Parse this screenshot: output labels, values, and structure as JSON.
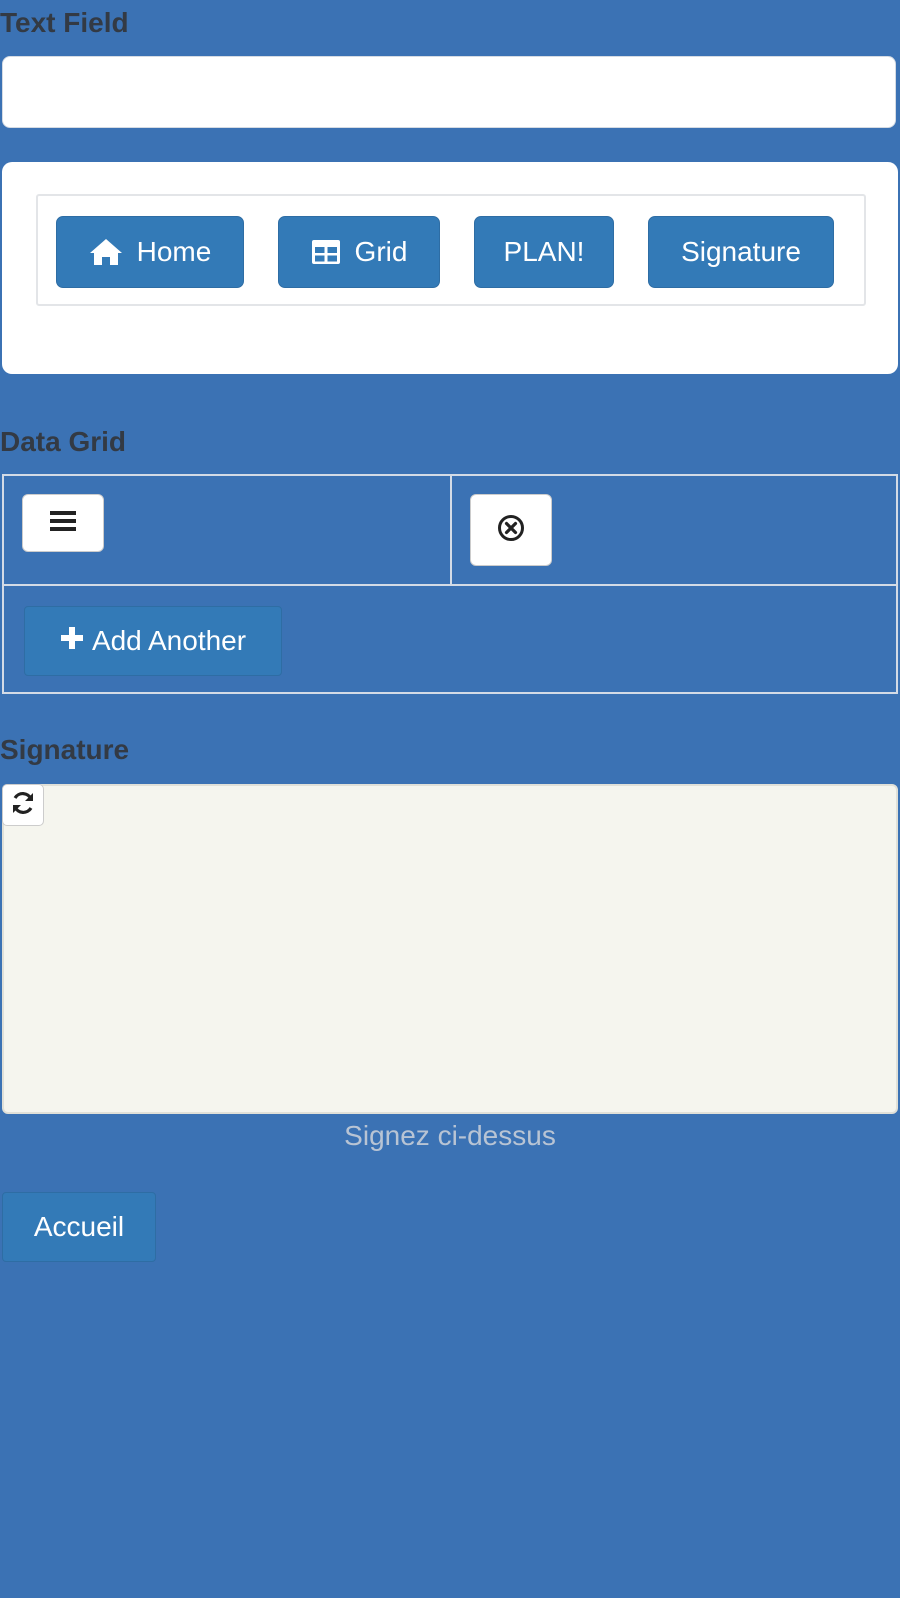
{
  "text_field": {
    "label": "Text Field",
    "value": "",
    "placeholder": ""
  },
  "nav": {
    "buttons": [
      {
        "label": "Home",
        "icon": "home-icon"
      },
      {
        "label": "Grid",
        "icon": "table-icon"
      },
      {
        "label": "PLAN!",
        "icon": ""
      },
      {
        "label": "Signature",
        "icon": ""
      }
    ]
  },
  "data_grid": {
    "label": "Data Grid",
    "row_menu_icon": "bars-icon",
    "row_remove_icon": "remove-circle-icon",
    "add_label": "Add Another",
    "add_icon": "plus-icon"
  },
  "signature": {
    "label": "Signature",
    "refresh_icon": "refresh-icon",
    "hint": "Signez ci-dessus"
  },
  "footer": {
    "accueil_label": "Accueil"
  },
  "colors": {
    "background": "#3b72b4",
    "button": "#337ab7",
    "signature_pad": "#f5f5ee"
  }
}
